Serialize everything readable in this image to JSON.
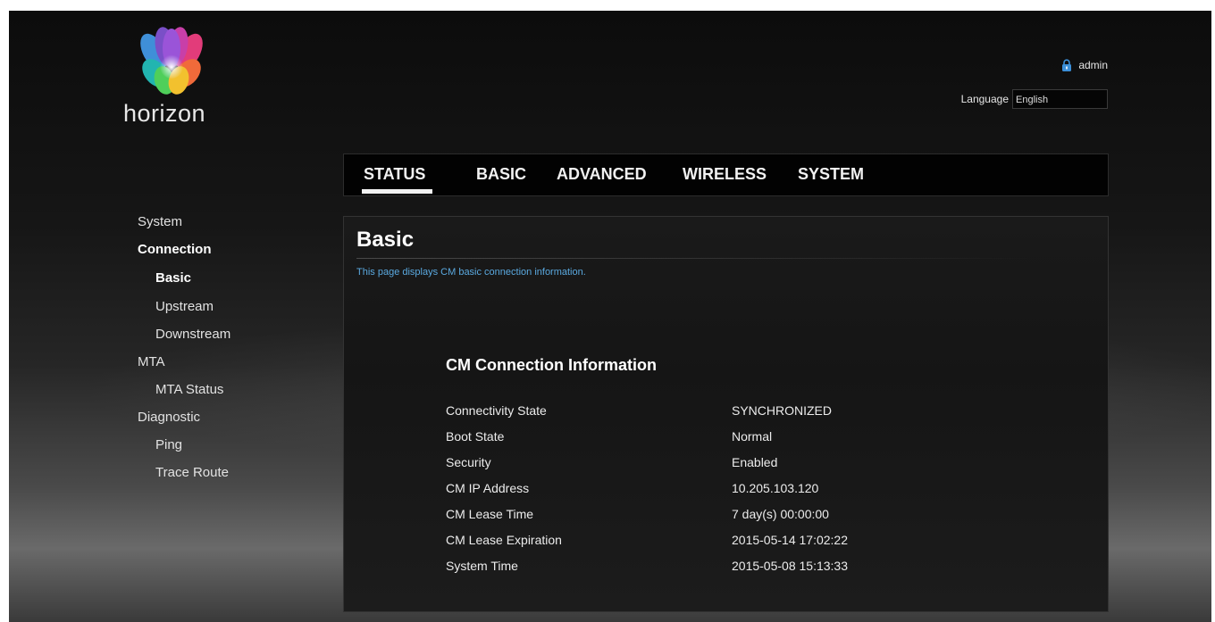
{
  "brand": {
    "name": "horizon"
  },
  "header": {
    "username": "admin",
    "language_label": "Language",
    "language_value": "English"
  },
  "nav": {
    "tabs": [
      {
        "label": "STATUS",
        "active": true
      },
      {
        "label": "BASIC",
        "active": false
      },
      {
        "label": "ADVANCED",
        "active": false
      },
      {
        "label": "WIRELESS",
        "active": false
      },
      {
        "label": "SYSTEM",
        "active": false
      }
    ]
  },
  "sidebar": {
    "items": [
      {
        "label": "System",
        "bold": false
      },
      {
        "label": "Connection",
        "bold": true
      },
      {
        "label": "Basic",
        "bold": true
      },
      {
        "label": "Upstream",
        "bold": false
      },
      {
        "label": "Downstream",
        "bold": false
      },
      {
        "label": "MTA",
        "bold": false
      },
      {
        "label": "MTA Status",
        "bold": false
      },
      {
        "label": "Diagnostic",
        "bold": false
      },
      {
        "label": "Ping",
        "bold": false
      },
      {
        "label": "Trace Route",
        "bold": false
      }
    ]
  },
  "main": {
    "title": "Basic",
    "description": "This page displays CM basic connection information.",
    "section_title": "CM Connection Information",
    "rows": [
      {
        "label": "Connectivity State",
        "value": "SYNCHRONIZED"
      },
      {
        "label": "Boot State",
        "value": "Normal"
      },
      {
        "label": "Security",
        "value": "Enabled"
      },
      {
        "label": "CM IP Address",
        "value": "10.205.103.120"
      },
      {
        "label": "CM Lease Time",
        "value": "7 day(s) 00:00:00"
      },
      {
        "label": "CM Lease Expiration",
        "value": "2015-05-14 17:02:22"
      },
      {
        "label": "System Time",
        "value": "2015-05-08 15:13:33"
      }
    ]
  },
  "colors": {
    "accent_link": "#5aa9e0",
    "background": "#111111",
    "text": "#ececec"
  },
  "icons": {
    "logo": "horizon-flower-logo",
    "user": "lock-icon"
  }
}
